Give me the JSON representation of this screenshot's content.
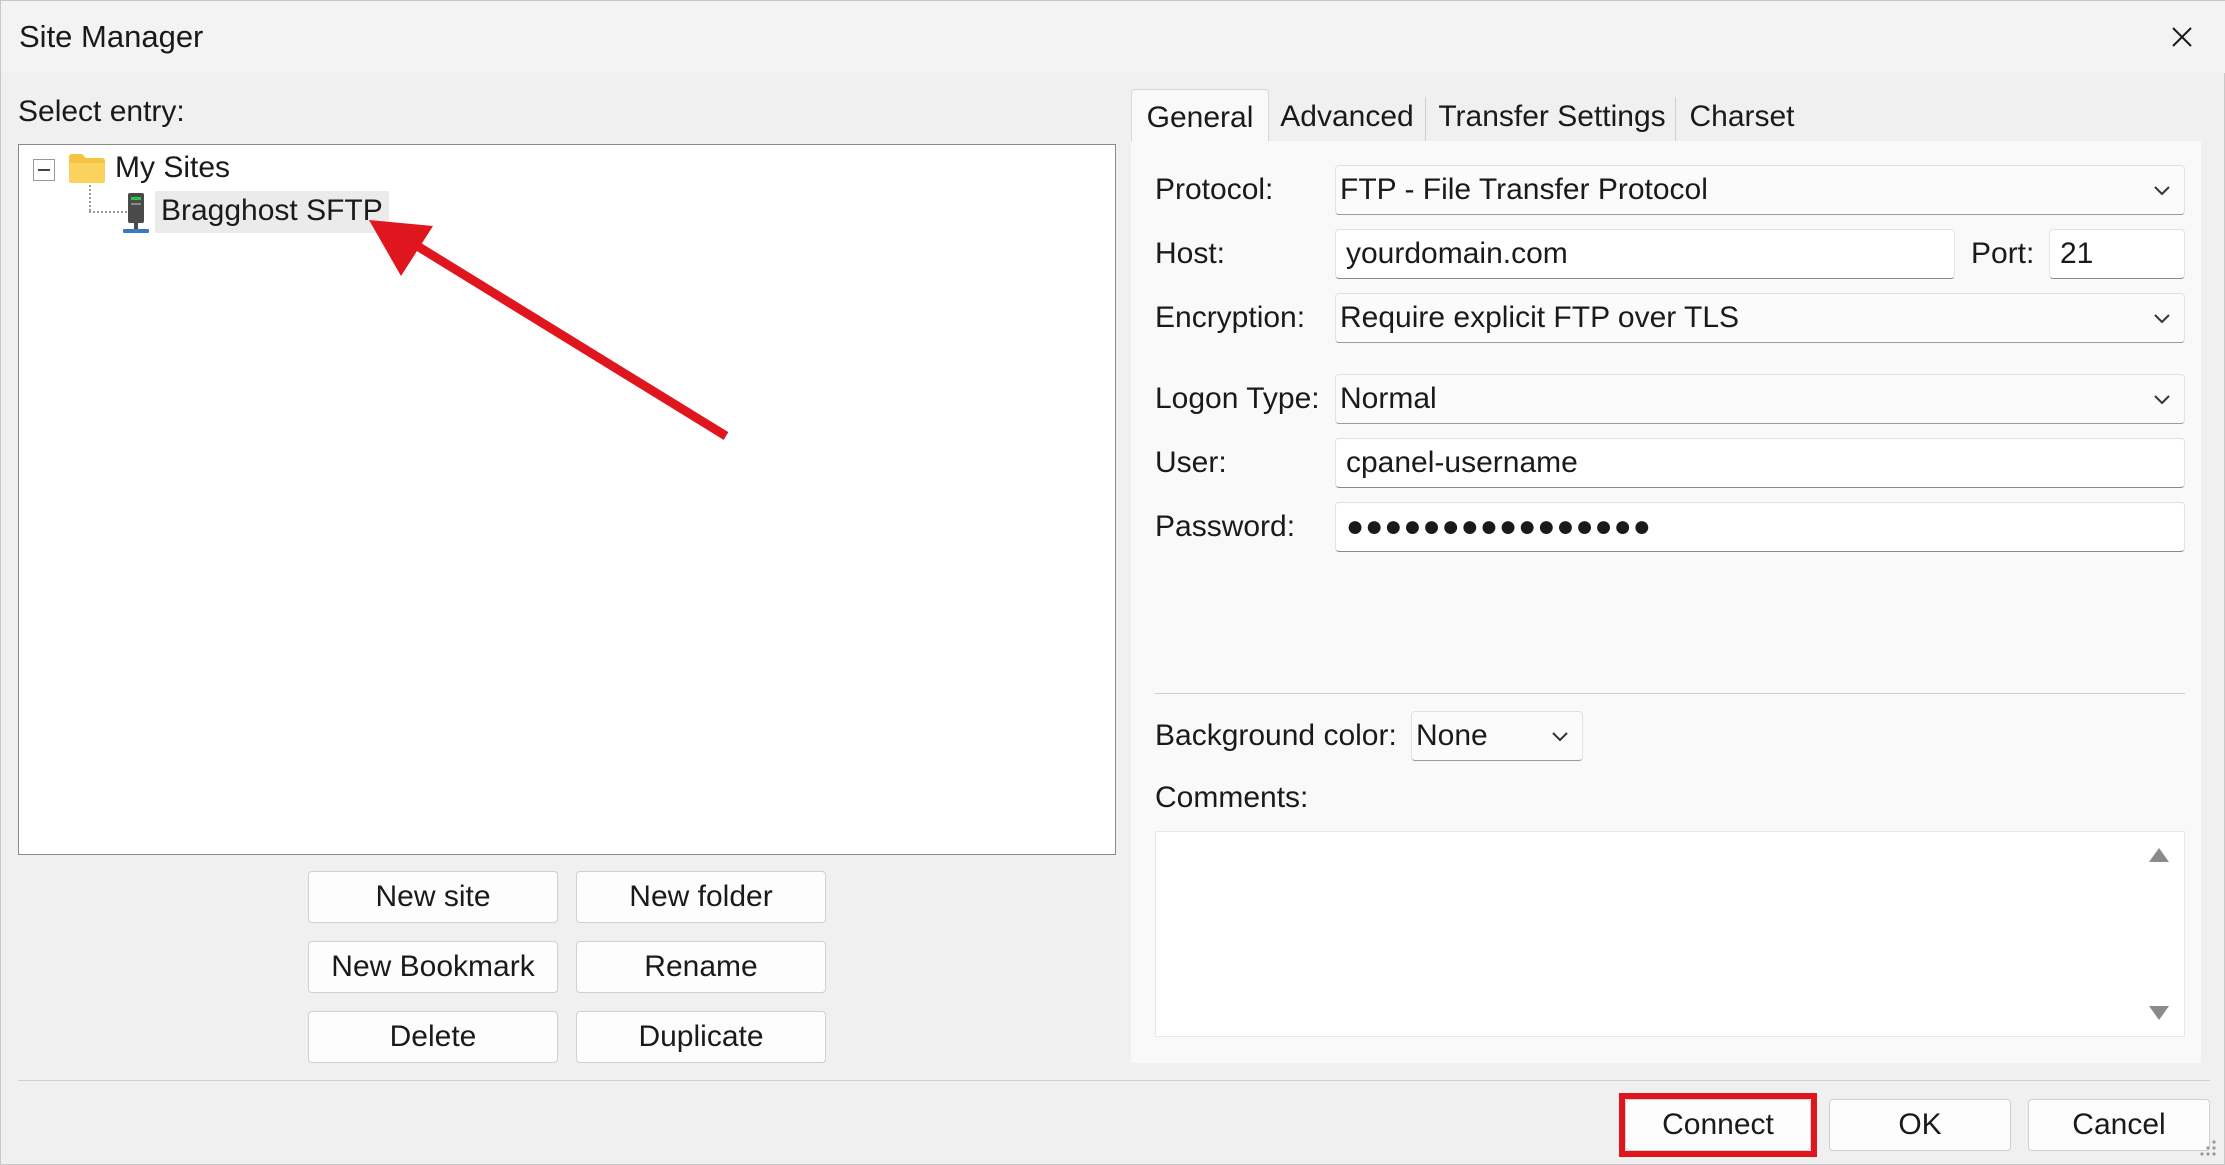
{
  "window": {
    "title": "Site Manager"
  },
  "left": {
    "select_entry_label": "Select entry:",
    "tree": {
      "root": "My Sites",
      "child": "Bragghost SFTP"
    },
    "buttons": {
      "new_site": "New site",
      "new_folder": "New folder",
      "new_bookmark": "New Bookmark",
      "rename": "Rename",
      "delete": "Delete",
      "duplicate": "Duplicate"
    }
  },
  "tabs": [
    "General",
    "Advanced",
    "Transfer Settings",
    "Charset"
  ],
  "general": {
    "protocol_label": "Protocol:",
    "protocol_value": "FTP - File Transfer Protocol",
    "host_label": "Host:",
    "host_value": "yourdomain.com",
    "port_label": "Port:",
    "port_value": "21",
    "encryption_label": "Encryption:",
    "encryption_value": "Require explicit FTP over TLS",
    "logon_type_label": "Logon Type:",
    "logon_type_value": "Normal",
    "user_label": "User:",
    "user_value": "cpanel-username",
    "password_label": "Password:",
    "password_value": "●●●●●●●●●●●●●●●●",
    "bg_color_label": "Background color:",
    "bg_color_value": "None",
    "comments_label": "Comments:"
  },
  "footer": {
    "connect": "Connect",
    "ok": "OK",
    "cancel": "Cancel"
  },
  "colors": {
    "annotation_red": "#e0161e",
    "folder_yellow": "#f6c344"
  },
  "icons": [
    "close-icon",
    "folder-icon",
    "server-icon",
    "chevron-down-icon",
    "scroll-up-icon",
    "scroll-down-icon",
    "resize-grip-icon"
  ]
}
